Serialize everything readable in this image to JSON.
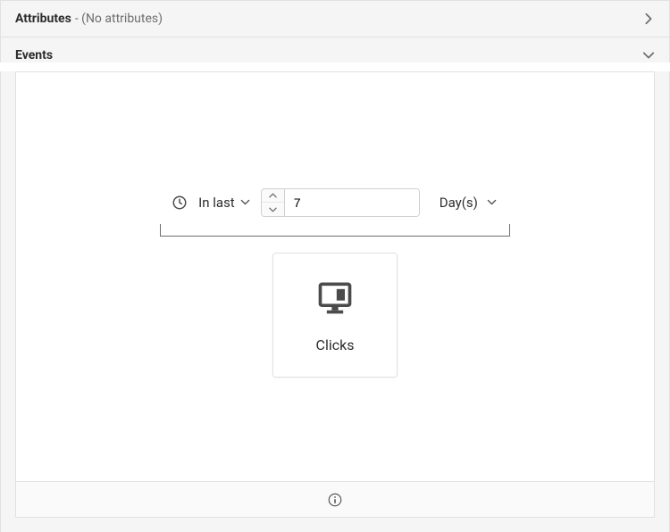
{
  "attributes": {
    "title": "Attributes",
    "subtitle": "- (No attributes)"
  },
  "events": {
    "title": "Events",
    "timeRange": {
      "operator_label": "In last",
      "value": "7",
      "unit_label": "Day(s)"
    },
    "card": {
      "label": "Clicks"
    }
  }
}
